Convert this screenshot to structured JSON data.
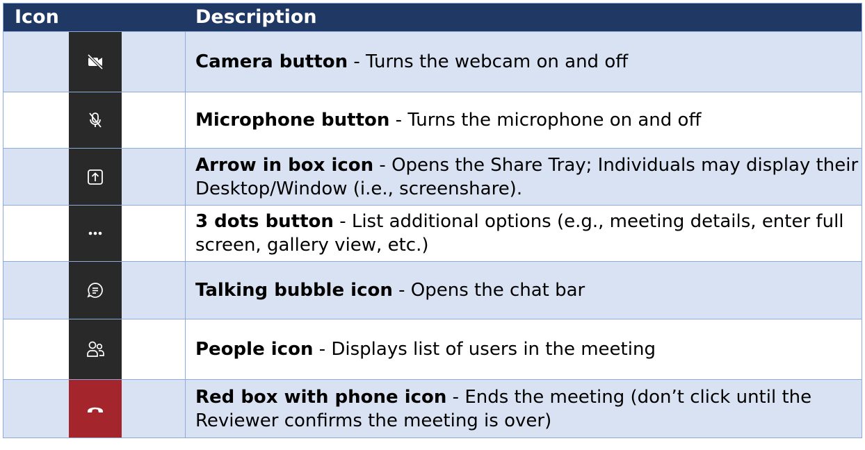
{
  "header": {
    "icon_col": "Icon",
    "desc_col": "Description"
  },
  "rows": [
    {
      "icon": "camera-off-icon",
      "title": "Camera button",
      "text": " - Turns the webcam on and off"
    },
    {
      "icon": "microphone-off-icon",
      "title": "Microphone button",
      "text": " - Turns the microphone on and off"
    },
    {
      "icon": "share-tray-icon",
      "title": "Arrow in box icon",
      "text": " - Opens the Share Tray; Individuals may display their Desktop/Window (i.e., screenshare)."
    },
    {
      "icon": "more-options-icon",
      "title": "3 dots button",
      "text": " - List additional options (e.g., meeting details, enter full screen, gallery view, etc.)"
    },
    {
      "icon": "chat-bubble-icon",
      "title": "Talking bubble icon",
      "text": " - Opens the chat bar"
    },
    {
      "icon": "people-icon",
      "title": "People icon",
      "text": " - Displays list of users in the meeting"
    },
    {
      "icon": "hang-up-phone-icon",
      "title": "Red box with phone icon",
      "text": " - Ends the meeting (don’t click until the Reviewer confirms the meeting is over)"
    }
  ],
  "colors": {
    "header_bg": "#1f3864",
    "alt_row_bg": "#d9e2f3",
    "border": "#8eaadb",
    "icon_bg": "#292929",
    "end_call_bg": "#a4262c"
  }
}
